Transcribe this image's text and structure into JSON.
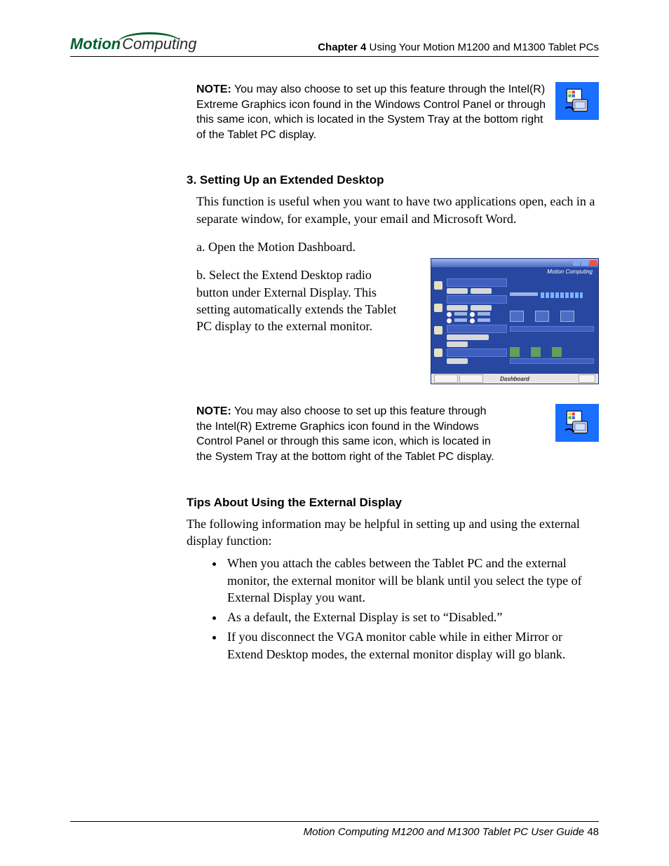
{
  "header": {
    "logo_motion": "Motion",
    "logo_computing": "Computing",
    "chapter_label": "Chapter 4",
    "chapter_title": "  Using Your Motion M1200 and M1300 Tablet PCs"
  },
  "note1": {
    "label": "NOTE:",
    "text": " You may also choose to set up this feature through the Intel(R) Extreme Graphics icon found in the Windows Control Panel or through this same icon, which is located in the System Tray at the bottom right of the Tablet PC display."
  },
  "section3": {
    "heading": "3. Setting Up an Extended Desktop",
    "intro": "This function is useful when you want to have two applications open, each in a separate window, for example, your email and Microsoft Word.",
    "step_a": "a. Open the Motion Dashboard.",
    "step_b": "b. Select the Extend Desktop radio button under External Display. This setting automatically extends the Tablet PC display to the external monitor."
  },
  "note2": {
    "label": "NOTE:",
    "text": " You may also choose to set up this feature through the Intel(R) Extreme Graphics icon found in the Windows Control Panel or through this same icon, which is located in the System Tray at the bottom right of the Tablet PC display."
  },
  "tips": {
    "heading": "Tips About Using the External Display",
    "intro": "The following information may be helpful in setting up and using the external display function:",
    "bullets": [
      "When you attach the cables between the Tablet PC and the external monitor, the external monitor will be blank until you select the type of External Display you want.",
      "As a default, the External Display is set to “Disabled.”",
      "If you disconnect the VGA monitor cable while in either Mirror or Extend Desktop modes, the external monitor display will go blank."
    ]
  },
  "dashboard_thumb": {
    "title": "Dashboard",
    "brand": "Motion Computing"
  },
  "footer": {
    "text": "Motion Computing M1200 and M1300 Tablet PC User Guide",
    "page": "48"
  }
}
